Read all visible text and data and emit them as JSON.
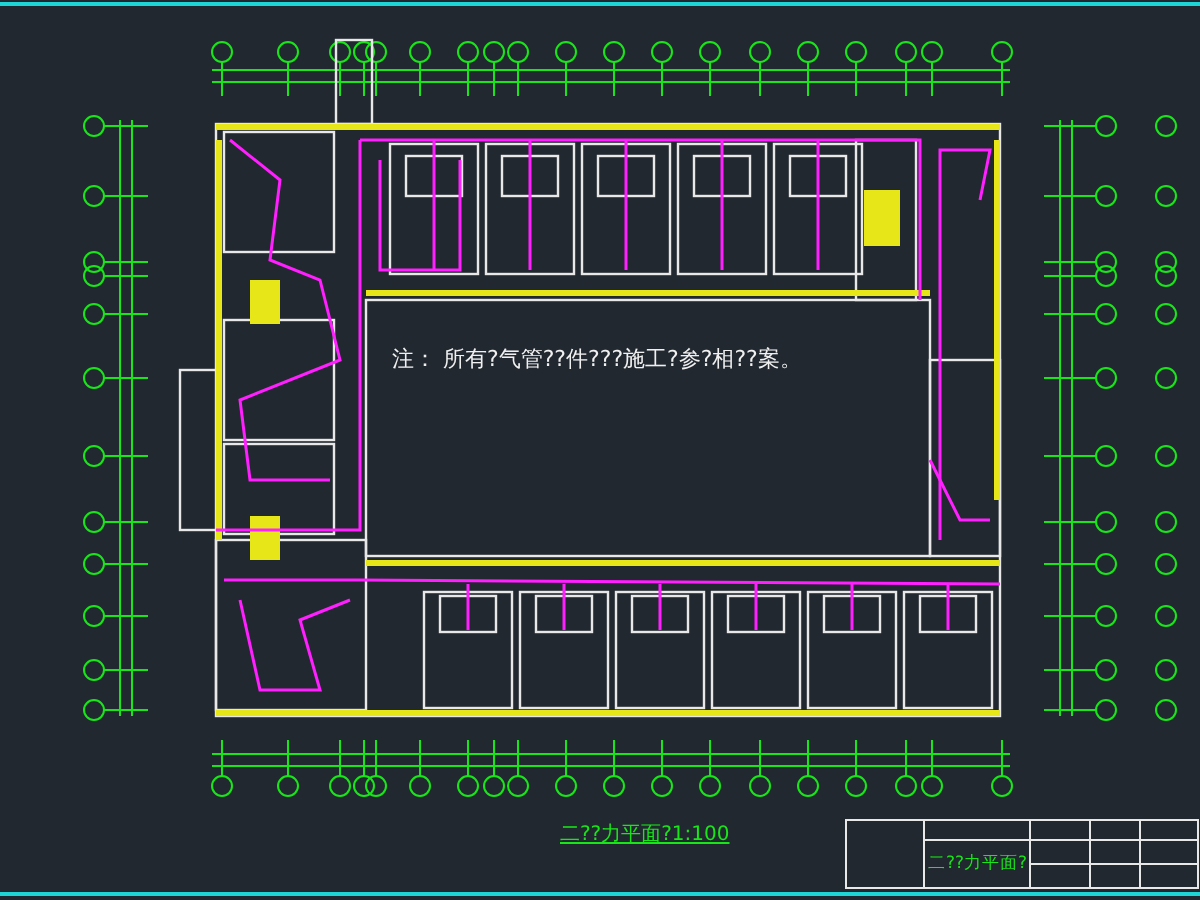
{
  "plan": {
    "note": "注： 所有?气管??件???施工?参?相??案。",
    "title": "二??力平面?1:100"
  },
  "title_block": {
    "drawing_title": "二??力平面?"
  }
}
